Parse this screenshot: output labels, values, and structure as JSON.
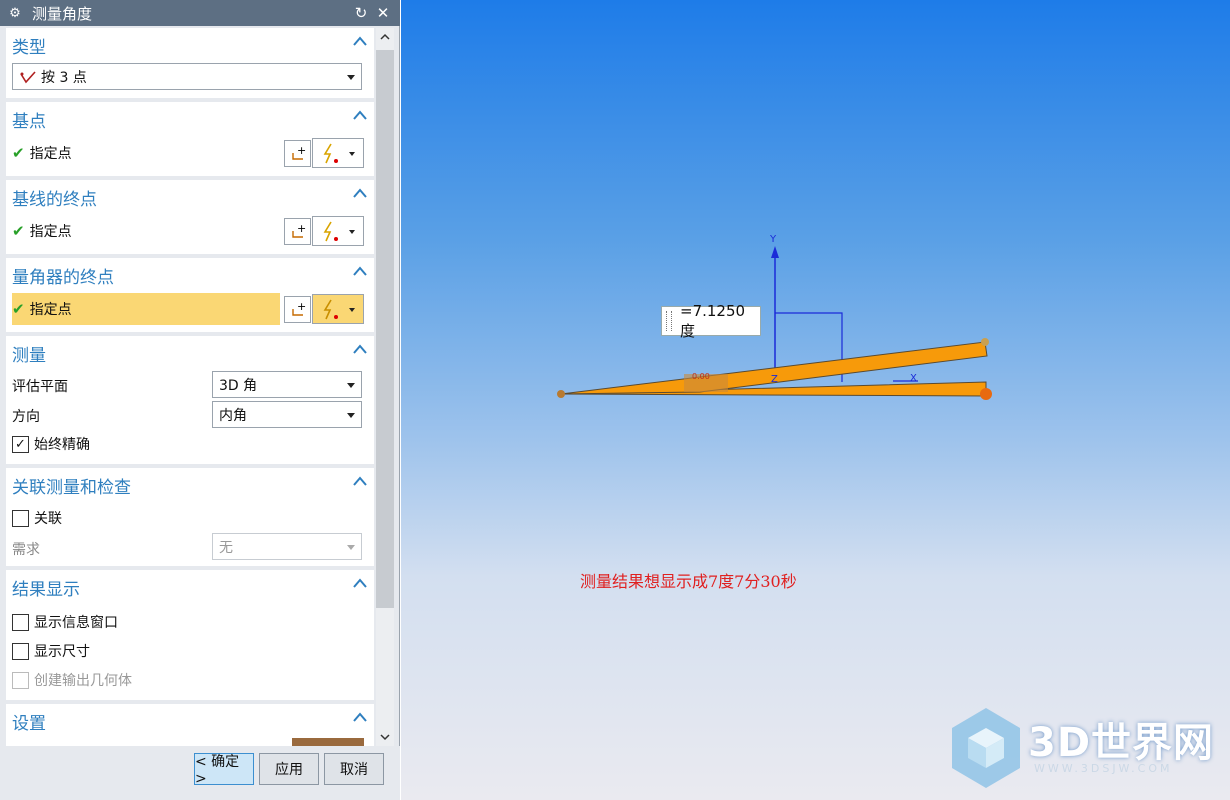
{
  "dialog": {
    "title": "测量角度",
    "sections": {
      "type": {
        "header": "类型",
        "value": "按 3 点"
      },
      "base_point": {
        "header": "基点",
        "label": "指定点"
      },
      "baseline_end": {
        "header": "基线的终点",
        "label": "指定点"
      },
      "protractor_end": {
        "header": "量角器的终点",
        "label": "指定点"
      },
      "measure": {
        "header": "测量",
        "eval_plane_label": "评估平面",
        "eval_plane_value": "3D 角",
        "direction_label": "方向",
        "direction_value": "内角",
        "always_exact_label": "始终精确"
      },
      "associative": {
        "header": "关联测量和检查",
        "assoc_label": "关联",
        "requirement_label": "需求",
        "requirement_value": "无"
      },
      "results": {
        "header": "结果显示",
        "show_info_label": "显示信息窗口",
        "show_dim_label": "显示尺寸",
        "create_geom_label": "创建输出几何体"
      },
      "settings": {
        "header": "设置"
      }
    },
    "buttons": {
      "ok": "< 确定 >",
      "apply": "应用",
      "cancel": "取消"
    }
  },
  "viewport": {
    "measurement": "=7.1250 度",
    "dim_small": "0.00",
    "axis_y": "Y",
    "axis_z": "Z",
    "axis_x": "X",
    "note": "测量结果想显示成7度7分30秒",
    "watermark_title": "3D世界网",
    "watermark_url": "WWW.3DSJW.COM"
  },
  "colors": {
    "titlebar": "#5d6f83",
    "section_header": "#2f7fbf",
    "active_row": "#fad774",
    "part": "#f79a0a",
    "note": "#e02020"
  }
}
